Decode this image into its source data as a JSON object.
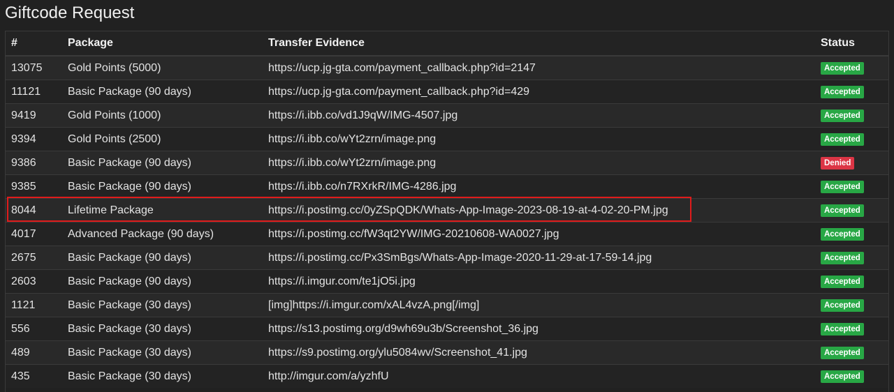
{
  "page": {
    "title": "Giftcode Request"
  },
  "table": {
    "headers": {
      "id": "#",
      "package": "Package",
      "evidence": "Transfer Evidence",
      "status": "Status"
    },
    "rows": [
      {
        "id": "13075",
        "package": "Gold Points (5000)",
        "evidence": "https://ucp.jg-gta.com/payment_callback.php?id=2147",
        "status": "Accepted"
      },
      {
        "id": "11121",
        "package": "Basic Package (90 days)",
        "evidence": "https://ucp.jg-gta.com/payment_callback.php?id=429",
        "status": "Accepted"
      },
      {
        "id": "9419",
        "package": "Gold Points (1000)",
        "evidence": "https://i.ibb.co/vd1J9qW/IMG-4507.jpg",
        "status": "Accepted"
      },
      {
        "id": "9394",
        "package": "Gold Points (2500)",
        "evidence": "https://i.ibb.co/wYt2zrn/image.png",
        "status": "Accepted"
      },
      {
        "id": "9386",
        "package": "Basic Package (90 days)",
        "evidence": "https://i.ibb.co/wYt2zrn/image.png",
        "status": "Denied"
      },
      {
        "id": "9385",
        "package": "Basic Package (90 days)",
        "evidence": "https://i.ibb.co/n7RXrkR/IMG-4286.jpg",
        "status": "Accepted"
      },
      {
        "id": "8044",
        "package": "Lifetime Package",
        "evidence": "https://i.postimg.cc/0yZSpQDK/Whats-App-Image-2023-08-19-at-4-02-20-PM.jpg",
        "status": "Accepted"
      },
      {
        "id": "4017",
        "package": "Advanced Package (90 days)",
        "evidence": "https://i.postimg.cc/fW3qt2YW/IMG-20210608-WA0027.jpg",
        "status": "Accepted"
      },
      {
        "id": "2675",
        "package": "Basic Package (90 days)",
        "evidence": "https://i.postimg.cc/Px3SmBgs/Whats-App-Image-2020-11-29-at-17-59-14.jpg",
        "status": "Accepted"
      },
      {
        "id": "2603",
        "package": "Basic Package (90 days)",
        "evidence": "https://i.imgur.com/te1jO5i.jpg",
        "status": "Accepted"
      },
      {
        "id": "1121",
        "package": "Basic Package (30 days)",
        "evidence": "[img]https://i.imgur.com/xAL4vzA.png[/img]",
        "status": "Accepted"
      },
      {
        "id": "556",
        "package": "Basic Package (30 days)",
        "evidence": "https://s13.postimg.org/d9wh69u3b/Screenshot_36.jpg",
        "status": "Accepted"
      },
      {
        "id": "489",
        "package": "Basic Package (30 days)",
        "evidence": "https://s9.postimg.org/ylu5084wv/Screenshot_41.jpg",
        "status": "Accepted"
      },
      {
        "id": "435",
        "package": "Basic Package (30 days)",
        "evidence": "http://imgur.com/a/yzhfU",
        "status": "Accepted"
      }
    ]
  },
  "colors": {
    "accepted": "#28a745",
    "denied": "#dc3545",
    "highlight": "#e01b1b"
  }
}
